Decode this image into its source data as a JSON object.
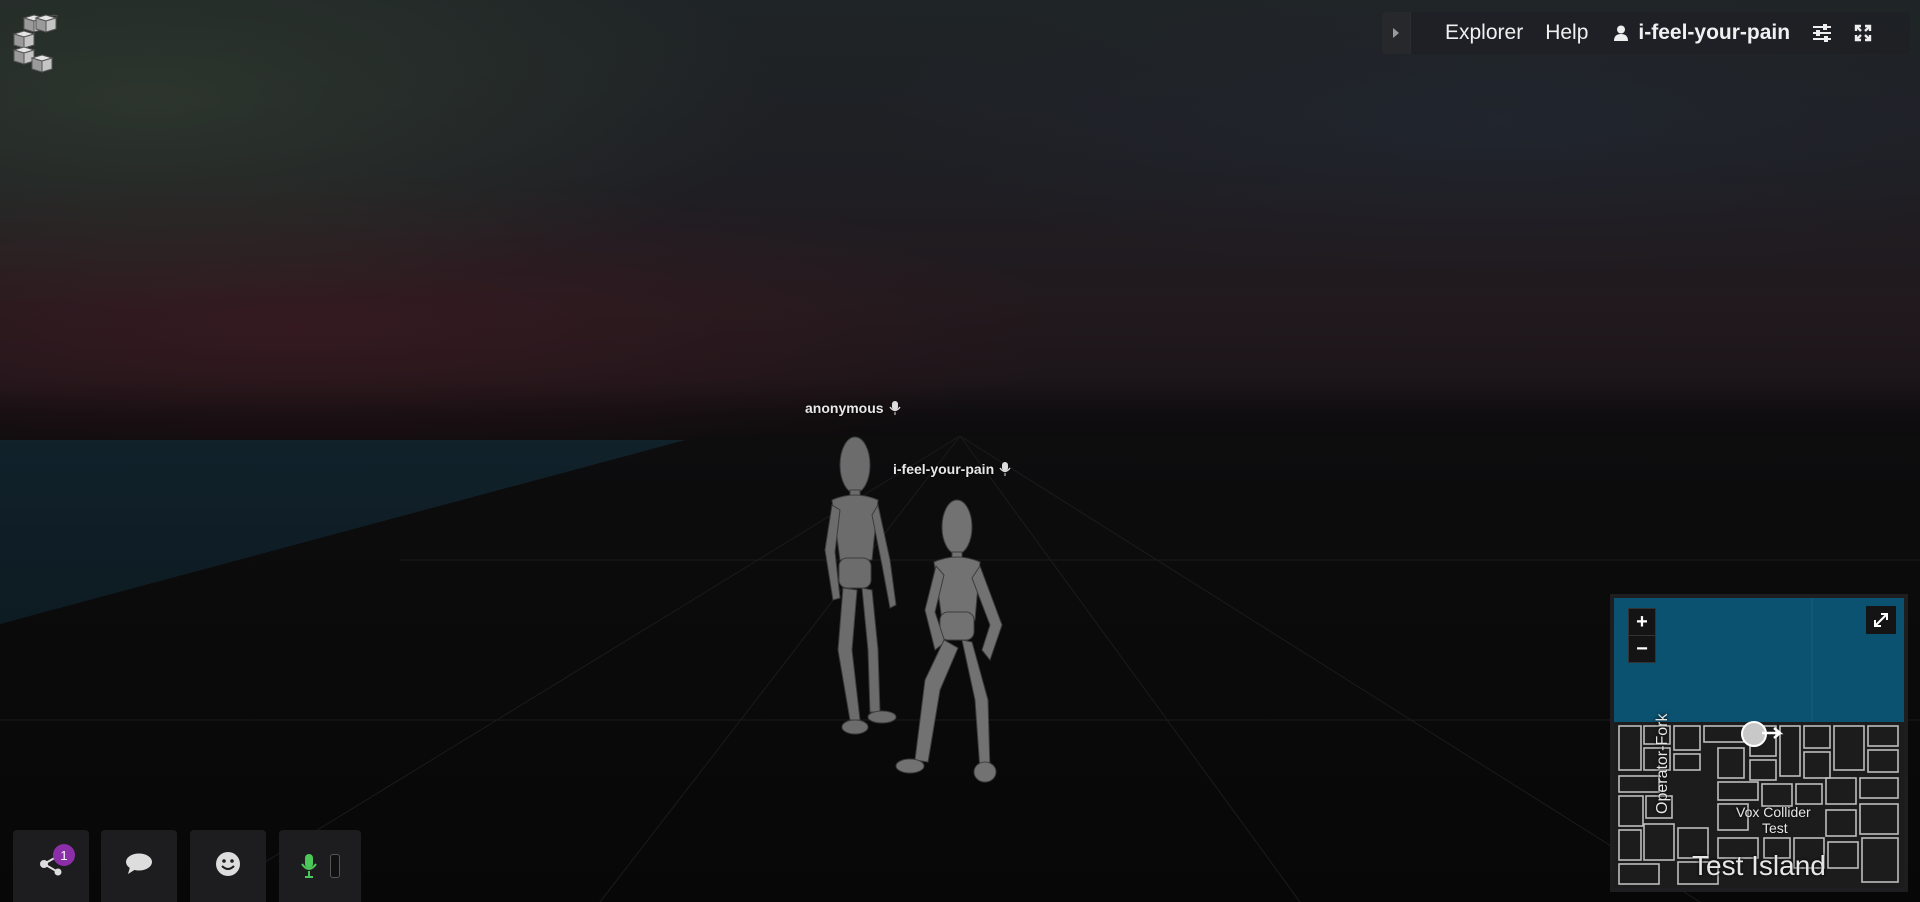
{
  "topbar": {
    "explorer_label": "Explorer",
    "explorer_mnemonic": "x",
    "help_label": "Help",
    "help_mnemonic": "H",
    "username": "i-feel-your-pain"
  },
  "scene": {
    "avatars": [
      {
        "name": "anonymous"
      },
      {
        "name": "i-feel-your-pain"
      }
    ]
  },
  "toolbar": {
    "share_badge": "1",
    "mic_color": "#4cc85a"
  },
  "minimap": {
    "zoom_in": "+",
    "zoom_out": "−",
    "labels": {
      "street": "Operator-Fork",
      "parcel_line1": "Vox Collider",
      "parcel_line2": "Test",
      "island": "Test Island"
    }
  },
  "icons": [
    "logo-icon",
    "collapse-arrow-icon",
    "user-icon",
    "settings-sliders-icon",
    "fullscreen-icon",
    "share-icon",
    "chat-icon",
    "emoji-icon",
    "microphone-icon",
    "expand-icon"
  ],
  "colors": {
    "map_water": "#0b5170",
    "badge": "#8b2fa8"
  }
}
